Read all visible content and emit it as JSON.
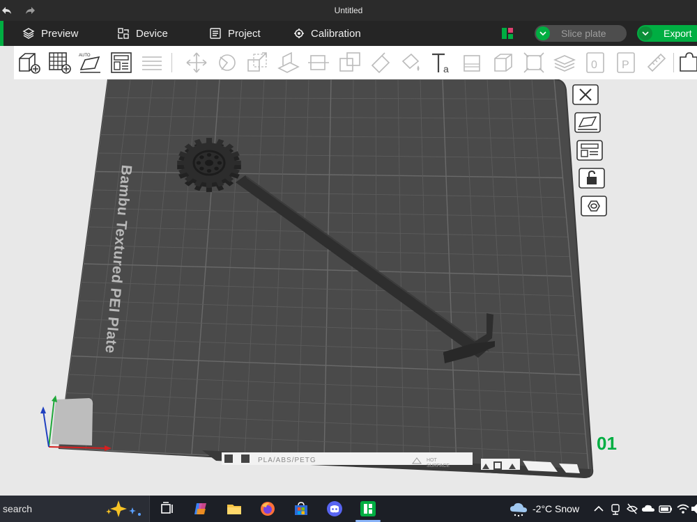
{
  "window": {
    "title": "Untitled"
  },
  "menu": {
    "preview": "Preview",
    "device": "Device",
    "project": "Project",
    "calibration": "Calibration",
    "slice": "Slice plate",
    "export": "Export"
  },
  "toolbar": {
    "auto_label": "AUTO"
  },
  "viewport": {
    "plate_name": "Bambu Textured PEI Plate",
    "plate_number": "01",
    "filament_label": "PLA/ABS/PETG",
    "hot_label_1": "HOT",
    "hot_label_2": "SURFACE"
  },
  "taskbar": {
    "search": "search",
    "weather": "-2°C  Snow"
  },
  "colors": {
    "accent": "#00ae42",
    "plate": "#4a4a4a",
    "model": "#323232"
  }
}
